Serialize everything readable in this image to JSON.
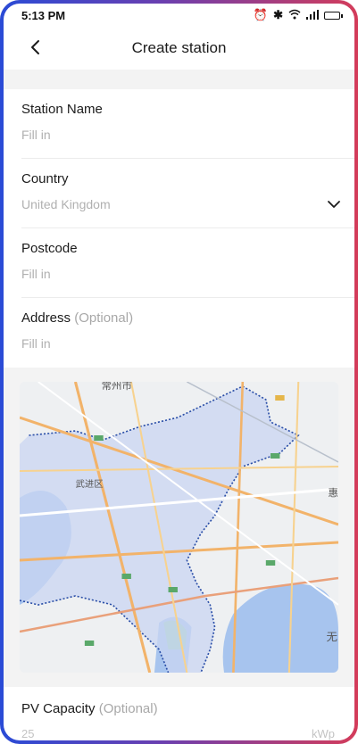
{
  "status_bar": {
    "time": "5:13 PM"
  },
  "header": {
    "title": "Create station"
  },
  "form": {
    "station_name": {
      "label": "Station Name",
      "value": "Fill in"
    },
    "country": {
      "label": "Country",
      "value": "United Kingdom"
    },
    "postcode": {
      "label": "Postcode",
      "value": "Fill in"
    },
    "address": {
      "label": "Address",
      "optional": "(Optional)",
      "value": "Fill in"
    }
  },
  "map": {
    "labels": {
      "top": "常州市",
      "district": "武进区",
      "right_1": "惠",
      "right_2": "无"
    }
  },
  "pv_capacity": {
    "label": "PV Capacity",
    "optional": "(Optional)",
    "value": "25",
    "unit": "kWp"
  }
}
